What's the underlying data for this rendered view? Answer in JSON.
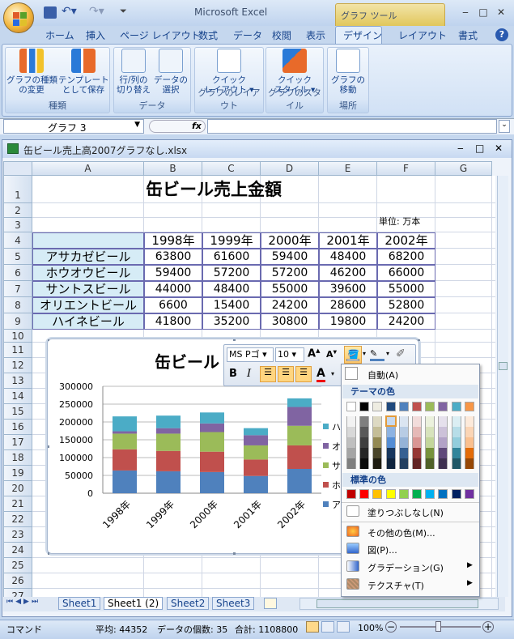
{
  "app": {
    "title": "Microsoft Excel",
    "context_tab_group": "グラフ ツール"
  },
  "window_buttons": {
    "min": "‒",
    "max": "□",
    "close": "✕",
    "wb_min": "‒",
    "wb_max": "□",
    "wb_close": "✕"
  },
  "tabs": [
    "ホーム",
    "挿入",
    "ページ レイアウト",
    "数式",
    "データ",
    "校閲",
    "表示",
    "デザイン",
    "レイアウト",
    "書式"
  ],
  "ribbon": {
    "groups": [
      {
        "label": "種類",
        "buttons": [
          "グラフの種類\nの変更",
          "テンプレート\nとして保存"
        ]
      },
      {
        "label": "データ",
        "buttons": [
          "行/列の\n切り替え",
          "データの\n選択"
        ]
      },
      {
        "label": "グラフのレイアウト",
        "buttons": [
          "クイック\nレイアウト ▾"
        ]
      },
      {
        "label": "グラフのスタイル",
        "buttons": [
          "クイック\nスタイル ▾"
        ]
      },
      {
        "label": "場所",
        "buttons": [
          "グラフの\n移動"
        ]
      }
    ]
  },
  "formula_bar": {
    "name_box": "グラフ 3",
    "fx": "fx",
    "formula": ""
  },
  "workbook": {
    "title": "缶ビール売上高2007グラフなし.xlsx"
  },
  "columns": [
    "A",
    "B",
    "C",
    "D",
    "E",
    "F",
    "G"
  ],
  "rows": [
    "1",
    "2",
    "3",
    "4",
    "5",
    "6",
    "7",
    "8",
    "9",
    "10",
    "11",
    "12",
    "13",
    "14",
    "15",
    "16",
    "17",
    "18",
    "19",
    "20",
    "21",
    "22",
    "23",
    "24",
    "25",
    "26",
    "27"
  ],
  "sheet": {
    "title": "缶ビール売上金額",
    "unit": "単位: 万本",
    "headers": [
      "1998年",
      "1999年",
      "2000年",
      "2001年",
      "2002年"
    ],
    "table": [
      {
        "name": "アサカゼビール",
        "values": [
          "63800",
          "61600",
          "59400",
          "48400",
          "68200"
        ]
      },
      {
        "name": "ホウオウビール",
        "values": [
          "59400",
          "57200",
          "57200",
          "46200",
          "66000"
        ]
      },
      {
        "name": "サントスビール",
        "values": [
          "44000",
          "48400",
          "55000",
          "39600",
          "55000"
        ]
      },
      {
        "name": "オリエントビール",
        "values": [
          "6600",
          "15400",
          "24200",
          "28600",
          "52800"
        ]
      },
      {
        "name": "ハイネビール",
        "values": [
          "41800",
          "35200",
          "30800",
          "19800",
          "24200"
        ]
      }
    ]
  },
  "chart_data": {
    "type": "bar",
    "stacked": true,
    "title": "缶ビール",
    "categories": [
      "1998年",
      "1999年",
      "2000年",
      "2001年",
      "2002年"
    ],
    "series": [
      {
        "name": "アサカゼビール",
        "legend_label": "ア",
        "color": "#4f81bd",
        "values": [
          63800,
          61600,
          59400,
          48400,
          68200
        ]
      },
      {
        "name": "ホウオウビール",
        "legend_label": "ホ",
        "color": "#c0504d",
        "values": [
          59400,
          57200,
          57200,
          46200,
          66000
        ]
      },
      {
        "name": "サントスビール",
        "legend_label": "サ",
        "color": "#9bbb59",
        "values": [
          44000,
          48400,
          55000,
          39600,
          55000
        ]
      },
      {
        "name": "オリエントビール",
        "legend_label": "オ",
        "color": "#8064a2",
        "values": [
          6600,
          15400,
          24200,
          28600,
          52800
        ]
      },
      {
        "name": "ハイネビール",
        "legend_label": "ハ",
        "color": "#4bacc6",
        "values": [
          41800,
          35200,
          30800,
          19800,
          24200
        ]
      }
    ],
    "yticks": [
      "300000",
      "250000",
      "200000",
      "150000",
      "100000",
      "50000",
      "0"
    ],
    "ylim": [
      0,
      300000
    ],
    "grid": true,
    "legend": "right"
  },
  "minibar": {
    "font": "MS Pゴ",
    "size": "10",
    "grow": "A",
    "shrink": "A",
    "bold": "B",
    "italic": "I"
  },
  "palette": {
    "auto": "自動(A)",
    "theme_header": "テーマの色",
    "standard_header": "標準の色",
    "no_fill": "塗りつぶしなし(N)",
    "more_colors": "その他の色(M)...",
    "picture": "図(P)...",
    "gradient": "グラデーション(G)",
    "texture": "テクスチャ(T)",
    "theme_colors": [
      "#ffffff",
      "#000000",
      "#eeece1",
      "#1f497d",
      "#4f81bd",
      "#c0504d",
      "#9bbb59",
      "#8064a2",
      "#4bacc6",
      "#f79646"
    ],
    "theme_shade_columns": [
      [
        "#f2f2f2",
        "#d8d8d8",
        "#bfbfbf",
        "#a5a5a5",
        "#7f7f7f"
      ],
      [
        "#7f7f7f",
        "#595959",
        "#3f3f3f",
        "#262626",
        "#0c0c0c"
      ],
      [
        "#ddd9c3",
        "#c4bd97",
        "#938953",
        "#494429",
        "#1d1b10"
      ],
      [
        "#c6d9f0",
        "#8db3e2",
        "#548dd4",
        "#17365d",
        "#0f243e"
      ],
      [
        "#dbe5f1",
        "#b8cce4",
        "#95b3d7",
        "#366092",
        "#244061"
      ],
      [
        "#f2dcdb",
        "#e5b9b7",
        "#d99694",
        "#953734",
        "#632423"
      ],
      [
        "#ebf1dd",
        "#d7e3bc",
        "#c3d69b",
        "#76923c",
        "#4f6128"
      ],
      [
        "#e5e0ec",
        "#ccc1d9",
        "#b2a2c7",
        "#5f497a",
        "#3f3151"
      ],
      [
        "#dbeef3",
        "#b7dde8",
        "#92cddc",
        "#31859b",
        "#205867"
      ],
      [
        "#fdeada",
        "#fbd5b5",
        "#fac08f",
        "#e36c09",
        "#974806"
      ]
    ],
    "standard_colors": [
      "#c00000",
      "#ff0000",
      "#ffc000",
      "#ffff00",
      "#92d050",
      "#00b050",
      "#00b0f0",
      "#0070c0",
      "#002060",
      "#7030a0"
    ]
  },
  "sheet_tabs": [
    "Sheet1",
    "Sheet1 (2)",
    "Sheet2",
    "Sheet3"
  ],
  "status": {
    "mode": "コマンド",
    "average": "平均: 44352",
    "count": "データの個数: 35",
    "sum": "合計: 1108800",
    "zoom": "100%"
  }
}
